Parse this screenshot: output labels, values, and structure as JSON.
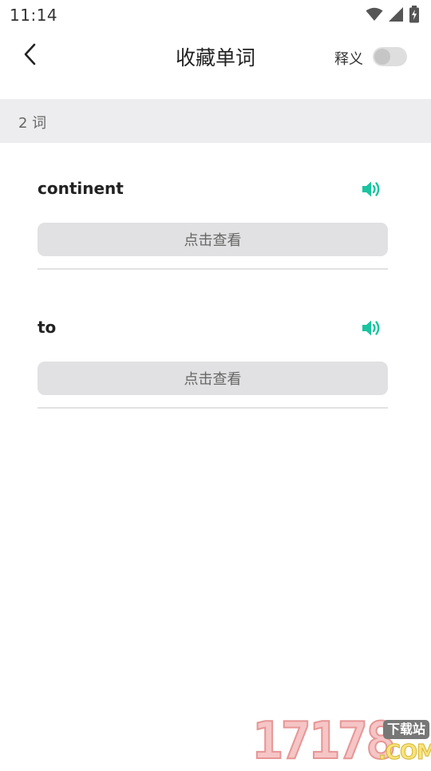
{
  "status_bar": {
    "time": "11:14",
    "icons": [
      "wifi-icon",
      "signal-icon",
      "battery-charging-icon"
    ]
  },
  "header": {
    "back_icon": "chevron-left-icon",
    "title": "收藏单词",
    "toggle_label": "释义",
    "toggle_on": false
  },
  "word_count": "2 词",
  "words": [
    {
      "word": "continent",
      "speaker_icon": "speaker-icon",
      "reveal_label": "点击查看"
    },
    {
      "word": "to",
      "speaker_icon": "speaker-icon",
      "reveal_label": "点击查看"
    }
  ],
  "watermark": {
    "digits": "17178",
    "badge": "下载站",
    "suffix": ".COM"
  },
  "colors": {
    "accent": "#1bc4a0",
    "count_bar_bg": "#ededef",
    "button_bg": "#e1e1e3"
  }
}
